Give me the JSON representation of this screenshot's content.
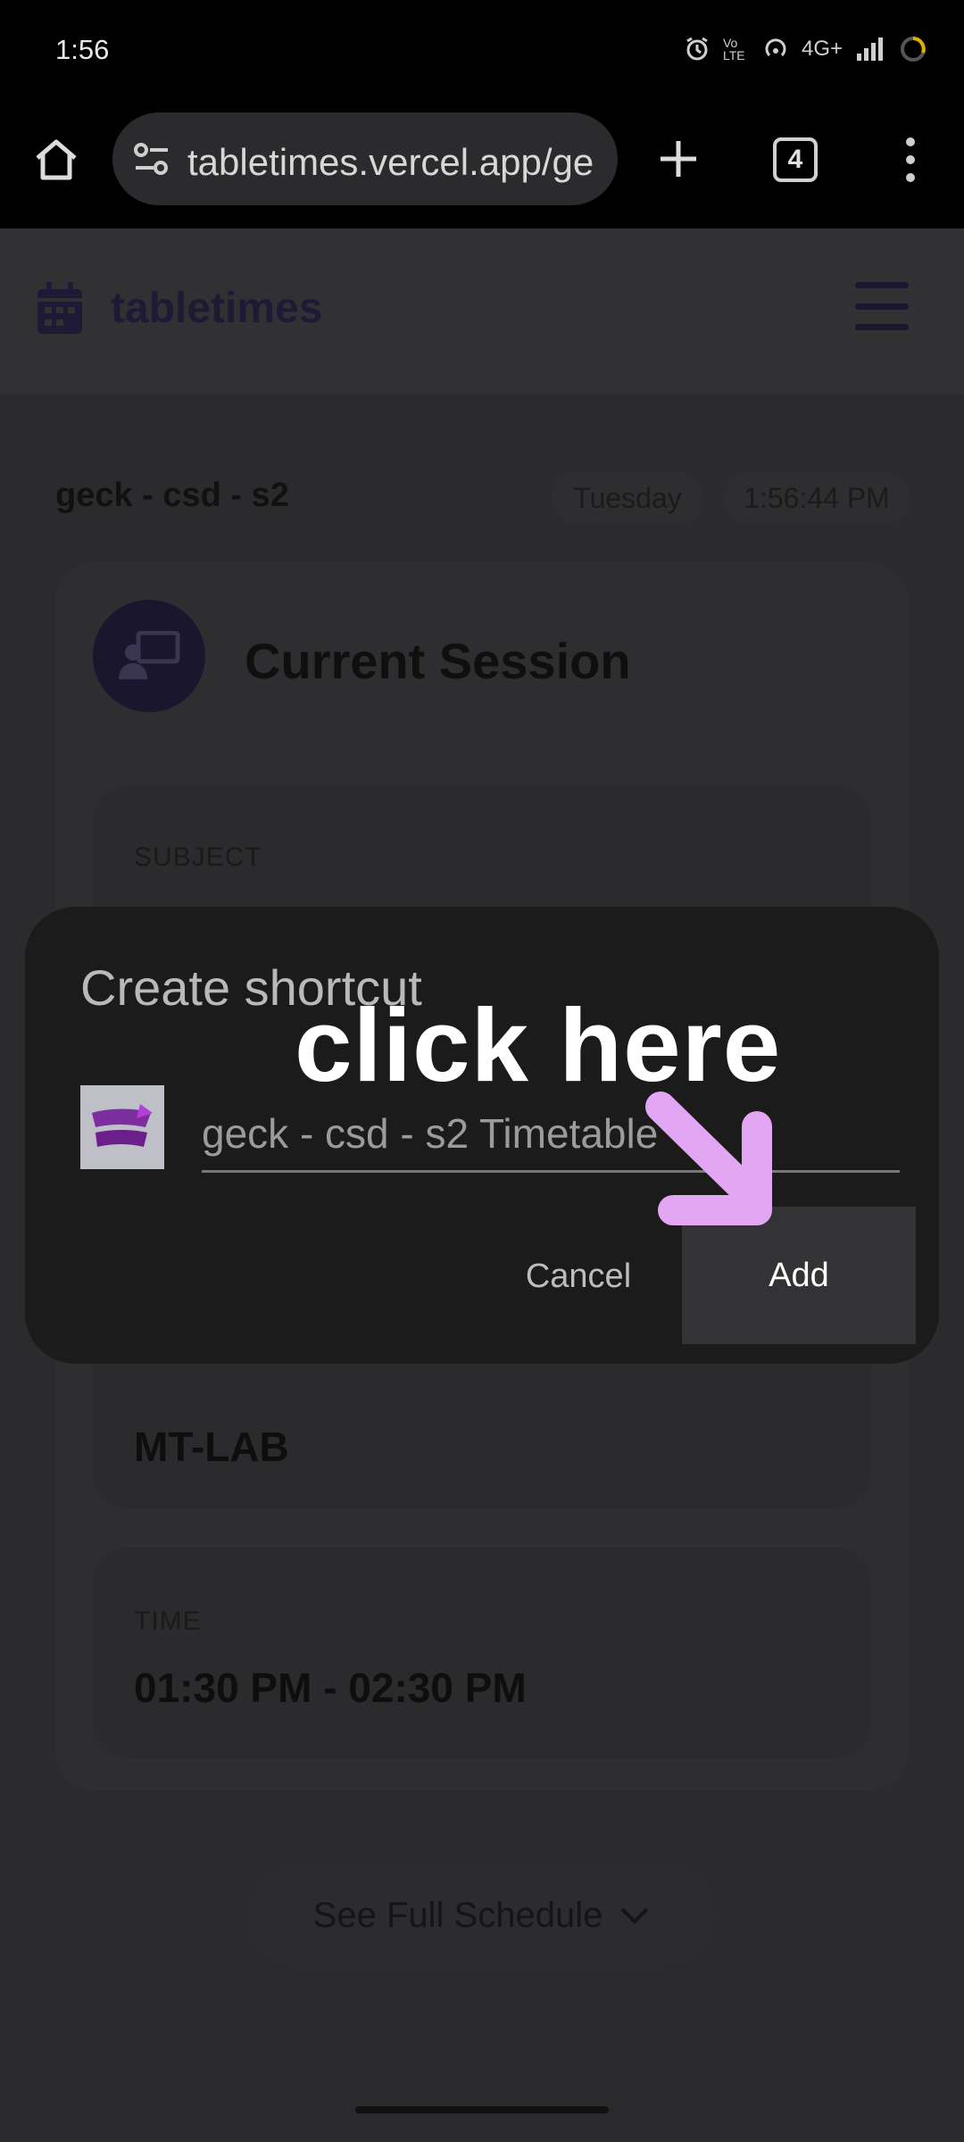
{
  "status_bar": {
    "time": "1:56",
    "network_label": "4G+",
    "volte_label": "Vo LTE"
  },
  "browser": {
    "url": "tabletimes.vercel.app/ge",
    "tab_count": "4"
  },
  "app": {
    "brand": "tabletimes"
  },
  "timetable": {
    "title": "geck - csd - s2",
    "day": "Tuesday",
    "clock": "1:56:44 PM",
    "session_title": "Current Session",
    "subject_label": "SUBJECT",
    "room_value": "MT-LAB",
    "time_label": "TIME",
    "time_value": "01:30 PM - 02:30 PM",
    "schedule_button": "See Full Schedule"
  },
  "dialog": {
    "title": "Create shortcut",
    "shortcut_name": "geck - csd - s2 Timetable",
    "cancel_label": "Cancel",
    "add_label": "Add"
  },
  "annotation": {
    "text": "click here",
    "arrow_color": "#e2a6f2"
  },
  "colors": {
    "brand": "#1e1a36",
    "dialog_bg": "#1b1b1b",
    "add_button_bg": "#333335"
  }
}
